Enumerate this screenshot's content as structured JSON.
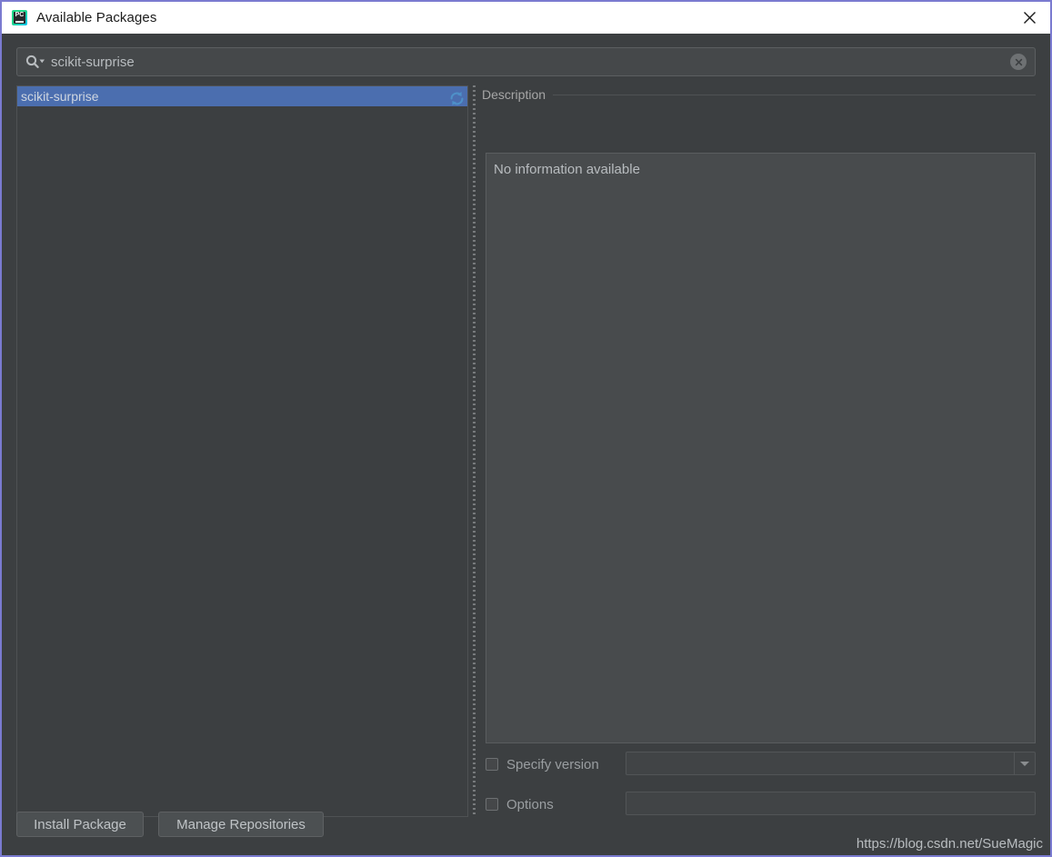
{
  "window": {
    "title": "Available Packages",
    "app_icon": "pycharm-icon",
    "close_icon": "close-icon",
    "accent_border": "#7a7ad0",
    "background": "#3c3f41",
    "selection_color": "#4b6eaf"
  },
  "search": {
    "icon": "search-icon",
    "value": "scikit-surprise",
    "placeholder": "",
    "clear_icon": "clear-icon"
  },
  "package_list": {
    "items": [
      {
        "name": "scikit-surprise",
        "selected": true
      }
    ],
    "refresh_icon": "refresh-icon"
  },
  "description": {
    "title": "Description",
    "body": "No information available"
  },
  "options": {
    "specify_version": {
      "label": "Specify version",
      "checked": false,
      "value": ""
    },
    "options_field": {
      "label": "Options",
      "checked": false,
      "value": ""
    }
  },
  "buttons": {
    "install": "Install Package",
    "manage": "Manage Repositories"
  },
  "watermark": "https://blog.csdn.net/SueMagic"
}
